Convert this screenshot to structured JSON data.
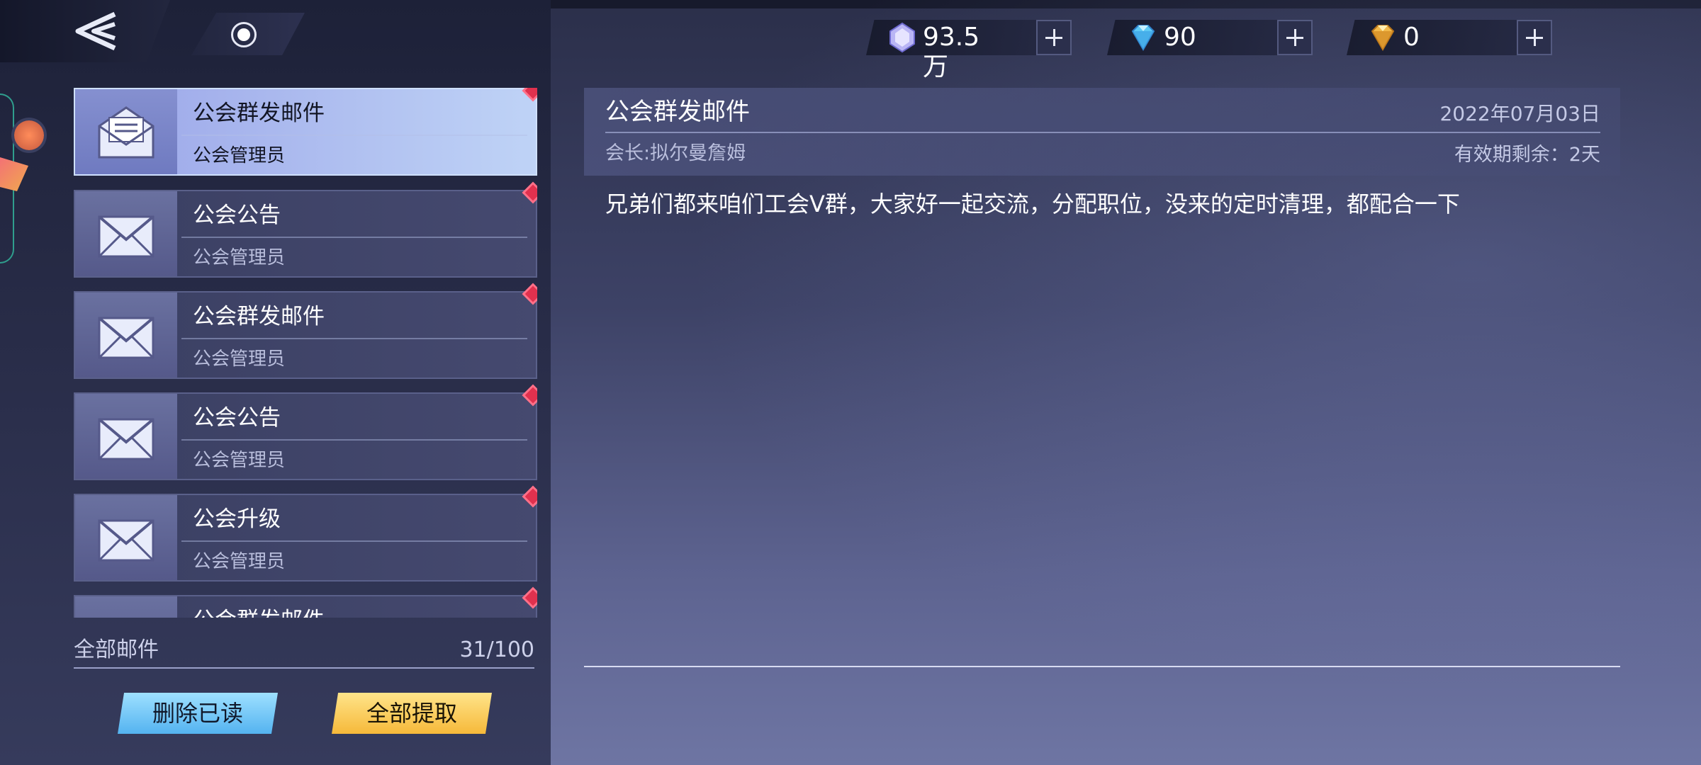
{
  "top_bar": {
    "back_icon": "double-chevron-left-icon",
    "camera_icon": "camera-record-icon"
  },
  "currencies": [
    {
      "name": "silver-gem",
      "amount": "93.5万",
      "color": "#b9b5f5"
    },
    {
      "name": "blue-diamond",
      "amount": "90",
      "color": "#5ecaf5"
    },
    {
      "name": "gold-diamond",
      "amount": "0",
      "color": "#f2b94a"
    }
  ],
  "mail_list": {
    "items": [
      {
        "title": "公会群发邮件",
        "sender": "公会管理员",
        "selected": true
      },
      {
        "title": "公会公告",
        "sender": "公会管理员",
        "selected": false
      },
      {
        "title": "公会群发邮件",
        "sender": "公会管理员",
        "selected": false
      },
      {
        "title": "公会公告",
        "sender": "公会管理员",
        "selected": false
      },
      {
        "title": "公会升级",
        "sender": "公会管理员",
        "selected": false
      },
      {
        "title": "公会群发邮件",
        "sender": "",
        "selected": false
      }
    ]
  },
  "footer": {
    "all_mail_label": "全部邮件",
    "count": "31/100",
    "delete_read_label": "删除已读",
    "claim_all_label": "全部提取"
  },
  "detail": {
    "title": "公会群发邮件",
    "date": "2022年07月03日",
    "sender": "会长:拟尔曼詹姆",
    "expiry": "有效期剩余：2天",
    "body": "兄弟们都来咱们工会V群，大家好一起交流，分配职位，没来的定时清理，都配合一下"
  }
}
